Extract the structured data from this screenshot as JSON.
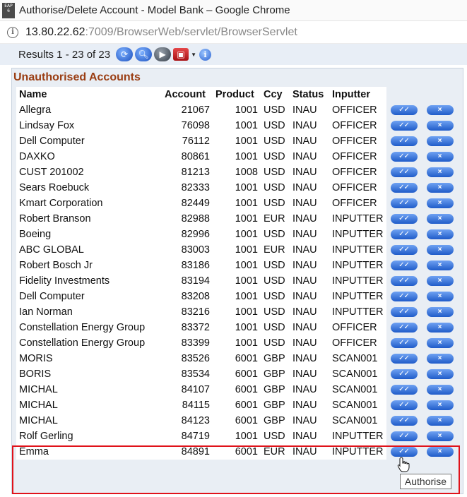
{
  "window": {
    "app_icon_lines": [
      "EAP",
      "6"
    ],
    "title": "Authorise/Delete Account - Model Bank – Google Chrome"
  },
  "address_bar": {
    "host": "13.80.22.62",
    "rest": ":7009/BrowserWeb/servlet/BrowserServlet"
  },
  "toolbar": {
    "results_text": "Results 1 - 23 of 23",
    "icons": [
      "refresh-icon",
      "find-icon",
      "next-icon",
      "tools-icon",
      "info-icon"
    ]
  },
  "section": {
    "title": "Unauthorised Accounts"
  },
  "table": {
    "headers": {
      "name": "Name",
      "account": "Account",
      "product": "Product",
      "ccy": "Ccy",
      "status": "Status",
      "inputter": "Inputter"
    },
    "rows": [
      {
        "name": "Allegra",
        "account": "21067",
        "product": "1001",
        "ccy": "USD",
        "status": "INAU",
        "inputter": "OFFICER"
      },
      {
        "name": "Lindsay Fox",
        "account": "76098",
        "product": "1001",
        "ccy": "USD",
        "status": "INAU",
        "inputter": "OFFICER"
      },
      {
        "name": "Dell Computer",
        "account": "76112",
        "product": "1001",
        "ccy": "USD",
        "status": "INAU",
        "inputter": "OFFICER"
      },
      {
        "name": "DAXKO",
        "account": "80861",
        "product": "1001",
        "ccy": "USD",
        "status": "INAU",
        "inputter": "OFFICER"
      },
      {
        "name": "CUST 201002",
        "account": "81213",
        "product": "1008",
        "ccy": "USD",
        "status": "INAU",
        "inputter": "OFFICER"
      },
      {
        "name": "Sears Roebuck",
        "account": "82333",
        "product": "1001",
        "ccy": "USD",
        "status": "INAU",
        "inputter": "OFFICER"
      },
      {
        "name": "Kmart Corporation",
        "account": "82449",
        "product": "1001",
        "ccy": "USD",
        "status": "INAU",
        "inputter": "OFFICER"
      },
      {
        "name": "Robert Branson",
        "account": "82988",
        "product": "1001",
        "ccy": "EUR",
        "status": "INAU",
        "inputter": "INPUTTER"
      },
      {
        "name": "Boeing",
        "account": "82996",
        "product": "1001",
        "ccy": "USD",
        "status": "INAU",
        "inputter": "INPUTTER"
      },
      {
        "name": "ABC GLOBAL",
        "account": "83003",
        "product": "1001",
        "ccy": "EUR",
        "status": "INAU",
        "inputter": "INPUTTER"
      },
      {
        "name": "Robert Bosch Jr",
        "account": "83186",
        "product": "1001",
        "ccy": "USD",
        "status": "INAU",
        "inputter": "INPUTTER"
      },
      {
        "name": "Fidelity Investments",
        "account": "83194",
        "product": "1001",
        "ccy": "USD",
        "status": "INAU",
        "inputter": "INPUTTER"
      },
      {
        "name": "Dell Computer",
        "account": "83208",
        "product": "1001",
        "ccy": "USD",
        "status": "INAU",
        "inputter": "INPUTTER"
      },
      {
        "name": "Ian Norman",
        "account": "83216",
        "product": "1001",
        "ccy": "USD",
        "status": "INAU",
        "inputter": "INPUTTER"
      },
      {
        "name": "Constellation Energy Group",
        "account": "83372",
        "product": "1001",
        "ccy": "USD",
        "status": "INAU",
        "inputter": "OFFICER"
      },
      {
        "name": "Constellation Energy Group",
        "account": "83399",
        "product": "1001",
        "ccy": "USD",
        "status": "INAU",
        "inputter": "OFFICER"
      },
      {
        "name": "MORIS",
        "account": "83526",
        "product": "6001",
        "ccy": "GBP",
        "status": "INAU",
        "inputter": "SCAN001"
      },
      {
        "name": "BORIS",
        "account": "83534",
        "product": "6001",
        "ccy": "GBP",
        "status": "INAU",
        "inputter": "SCAN001"
      },
      {
        "name": "MICHAL",
        "account": "84107",
        "product": "6001",
        "ccy": "GBP",
        "status": "INAU",
        "inputter": "SCAN001"
      },
      {
        "name": "MICHAL",
        "account": "84115",
        "product": "6001",
        "ccy": "GBP",
        "status": "INAU",
        "inputter": "SCAN001"
      },
      {
        "name": "MICHAL",
        "account": "84123",
        "product": "6001",
        "ccy": "GBP",
        "status": "INAU",
        "inputter": "SCAN001"
      },
      {
        "name": "Rolf Gerling",
        "account": "84719",
        "product": "1001",
        "ccy": "USD",
        "status": "INAU",
        "inputter": "INPUTTER"
      },
      {
        "name": "Emma",
        "account": "84891",
        "product": "6001",
        "ccy": "EUR",
        "status": "INAU",
        "inputter": "INPUTTER"
      }
    ]
  },
  "tooltip": {
    "text": "Authorise"
  },
  "colors": {
    "section_title": "#9a3d12",
    "panel_background": "#e9eef4",
    "highlight_border": "#e0121a",
    "button_blue": "#1f5cc9"
  }
}
